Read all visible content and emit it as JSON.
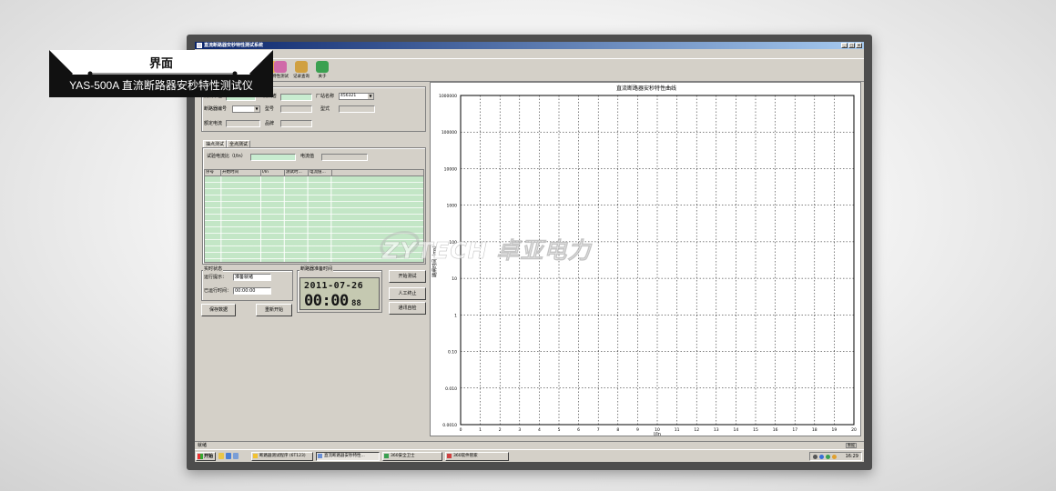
{
  "banner": {
    "title": "界面",
    "subtitle": "YAS-500A 直流断路器安秒特性测试仪"
  },
  "window": {
    "title": "直流断路器安秒特性测试系统",
    "buttons": [
      "_",
      "□",
      "×"
    ]
  },
  "menu": [
    "文件",
    "设置",
    "操作",
    "查看",
    "帮助"
  ],
  "toolbar": [
    {
      "label": "",
      "icon": "folder-icon",
      "color": "#e9c64a"
    },
    {
      "label": "",
      "icon": "save-icon",
      "color": "#6a8fd4"
    },
    {
      "label": "",
      "icon": "settings-icon",
      "color": "#c7a3e0"
    },
    {
      "label": "",
      "icon": "plot-icon",
      "color": "#e8b050"
    },
    {
      "label": "特性测试",
      "icon": "test-icon",
      "color": "#d06aa8"
    },
    {
      "label": "记录查询",
      "icon": "records-icon",
      "color": "#d0a040"
    },
    {
      "label": "关于",
      "icon": "about-icon",
      "color": "#3aa050"
    }
  ],
  "info": {
    "test_unit_label": "测试单位",
    "tester_label": "测试者",
    "factory_label": "厂站名称",
    "factory_value": "456321",
    "breaker_no_label": "断路器编号",
    "model_label": "型号",
    "type_label": "型式",
    "rated_current_label": "额定电流",
    "brand_label": "品牌"
  },
  "tabs": [
    "抽点测试",
    "全点测试"
  ],
  "test": {
    "ratio_label": "试验电流比（I/In）",
    "current_label": "电流值"
  },
  "table": {
    "columns": [
      "序号",
      "开始时间",
      "I/In",
      "测试时...",
      "电流值..."
    ]
  },
  "status": {
    "group_title": "实时状态",
    "hint_label": "运行提示：",
    "hint_value": "准备就绪",
    "elapsed_label": "已运行时间：",
    "elapsed_value": "00:00:00",
    "save_button": "保存数据",
    "restart_button": "重新开始"
  },
  "clock": {
    "group_title": "断路器准备时间",
    "date": "2011-07-26",
    "time": "00:00",
    "seconds": "88"
  },
  "actions": {
    "start": "开始测试",
    "stop": "人工终止",
    "comm_check": "通讯自检"
  },
  "chart_data": {
    "type": "line",
    "title": "直流断路器安秒特性曲线",
    "xlabel": "I/In",
    "ylabel": "跳闸时间（ms）",
    "x_ticks": [
      "0",
      "1",
      "2",
      "3",
      "4",
      "5",
      "6",
      "7",
      "8",
      "9",
      "10",
      "11",
      "12",
      "13",
      "14",
      "15",
      "16",
      "17",
      "18",
      "19",
      "20"
    ],
    "y_ticks": [
      "0.0010",
      "0.010",
      "0.10",
      "1",
      "10",
      "100",
      "1000",
      "10000",
      "100000",
      "1000000"
    ],
    "xlim": [
      0,
      20
    ],
    "ylim": [
      0.001,
      1000000
    ],
    "yscale": "log",
    "grid": true,
    "series": []
  },
  "statusbar": {
    "left": "就绪",
    "right": "数据"
  },
  "taskbar": {
    "start": "开始",
    "items": [
      "断路器测试程序 (6T123)",
      "直流断路器安秒特性...",
      "360安全卫士",
      "360软件管家"
    ],
    "clock": "16:29"
  },
  "watermark": "ZYTECH 卓亚电力"
}
